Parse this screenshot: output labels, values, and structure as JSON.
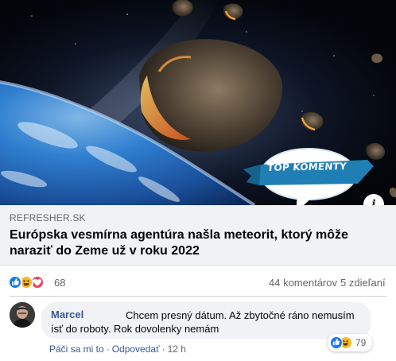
{
  "hero": {
    "badge_text": "TOP KOMENTY",
    "info_label": "i",
    "colors": {
      "space": "#05070d",
      "earth": "#2f7fd0",
      "badge": "#1f7fb4"
    }
  },
  "link_preview": {
    "domain": "REFRESHER.SK",
    "headline": "Európska vesmírna agentúra našla meteorit, ktorý môže naraziť do Zeme už v roku 2022"
  },
  "reactions": {
    "icons": [
      "like-icon",
      "haha-icon",
      "love-icon"
    ],
    "count": "68",
    "comments": "44 komentárov",
    "shares": "5 zdieľaní"
  },
  "comment": {
    "author": "Marcel",
    "text": "Chcem presný dátum. Až zbytočné ráno nemusím ísť do roboty. Rok dovolenky nemám",
    "reaction_icons": [
      "like-icon",
      "haha-icon"
    ],
    "reaction_count": "79",
    "actions": {
      "like": "Páči sa mi to",
      "reply": "Odpovedať",
      "time": "12 h"
    }
  },
  "colors": {
    "link_blue": "#385898",
    "muted": "#65676b",
    "like_blue": "#1877f2",
    "haha_yellow": "#f7b928",
    "love_red": "#f33e58"
  }
}
